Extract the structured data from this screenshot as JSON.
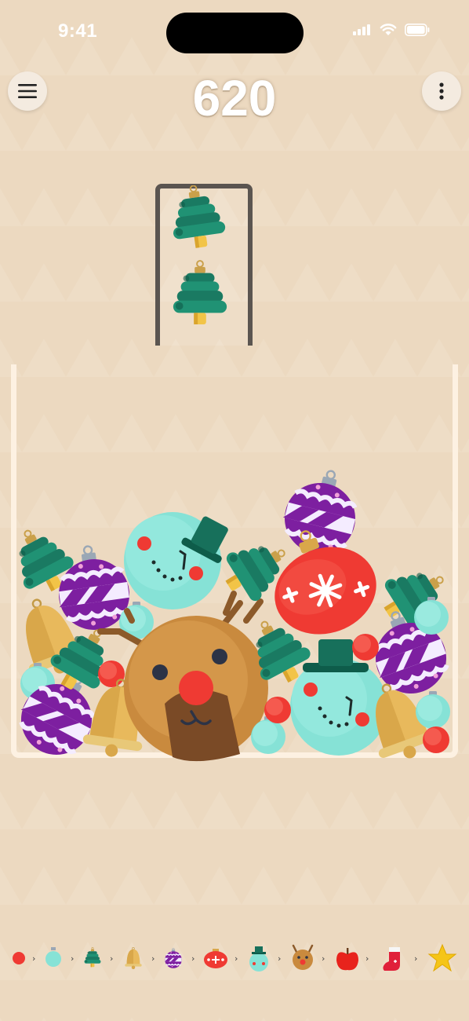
{
  "status": {
    "time": "9:41"
  },
  "toolbar": {
    "menu_icon": "hamburger-menu-icon",
    "more_icon": "vertical-ellipsis-icon"
  },
  "game": {
    "score": "620",
    "next_queue": [
      "christmas-tree-ornament",
      "christmas-tree-ornament"
    ],
    "jar_contents": [
      "purple-ornament",
      "christmas-tree-ornament",
      "snowman-ornament",
      "red-snowflake-ornament",
      "purple-ornament",
      "christmas-tree-ornament",
      "christmas-tree-ornament",
      "christmas-tree-ornament",
      "golden-bell",
      "reindeer",
      "snowman-ornament",
      "purple-ornament",
      "christmas-tree-ornament",
      "teal-ornament",
      "teal-ornament",
      "teal-ornament",
      "teal-ornament",
      "teal-ornament",
      "red-ball",
      "red-ball",
      "red-ball",
      "red-ball",
      "purple-ornament",
      "golden-bell",
      "golden-bell",
      "christmas-tree-ornament"
    ]
  },
  "evolution_chain": [
    "red-ball",
    "teal-ornament",
    "christmas-tree-ornament",
    "golden-bell",
    "purple-ornament",
    "red-snowflake-ornament",
    "snowman-ornament",
    "reindeer",
    "red-apple",
    "christmas-stocking",
    "gold-star"
  ],
  "colors": {
    "background": "#ecd9c0",
    "jar_border": "#fdf1e2",
    "chute_border": "#5b5550",
    "red": "#ef3a33",
    "teal": "#86e2d6",
    "tree_green": "#1e8a6e",
    "gold": "#e8b95c",
    "purple": "#7d1fa0",
    "reindeer_brown": "#c98a3e",
    "star_yellow": "#f5c518"
  }
}
